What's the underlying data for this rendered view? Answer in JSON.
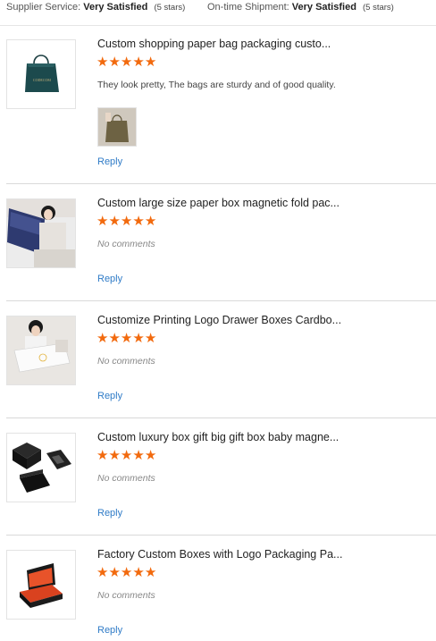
{
  "summary": {
    "supplier_service_label": "Supplier Service:",
    "supplier_service_value": "Very Satisfied",
    "supplier_service_stars": "(5 stars)",
    "shipment_label": "On-time Shipment:",
    "shipment_value": "Very Satisfied",
    "shipment_stars": "(5 stars)"
  },
  "colors": {
    "star": "#f26a0e",
    "link": "#2f7bc7"
  },
  "reviews": [
    {
      "title": "Custom shopping paper bag packaging custo...",
      "rating": 5,
      "comment": "They look pretty, The bags are sturdy and of good quality.",
      "has_attachment": true,
      "reply": "Reply"
    },
    {
      "title": "Custom large size paper box magnetic fold pac...",
      "rating": 5,
      "comment": "No comments",
      "reply": "Reply"
    },
    {
      "title": "Customize Printing Logo Drawer Boxes Cardbo...",
      "rating": 5,
      "comment": "No comments",
      "reply": "Reply"
    },
    {
      "title": "Custom luxury box gift big gift box baby magne...",
      "rating": 5,
      "comment": "No comments",
      "reply": "Reply"
    },
    {
      "title": "Factory Custom Boxes with Logo Packaging Pa...",
      "rating": 5,
      "comment": "No comments",
      "reply": "Reply"
    }
  ]
}
